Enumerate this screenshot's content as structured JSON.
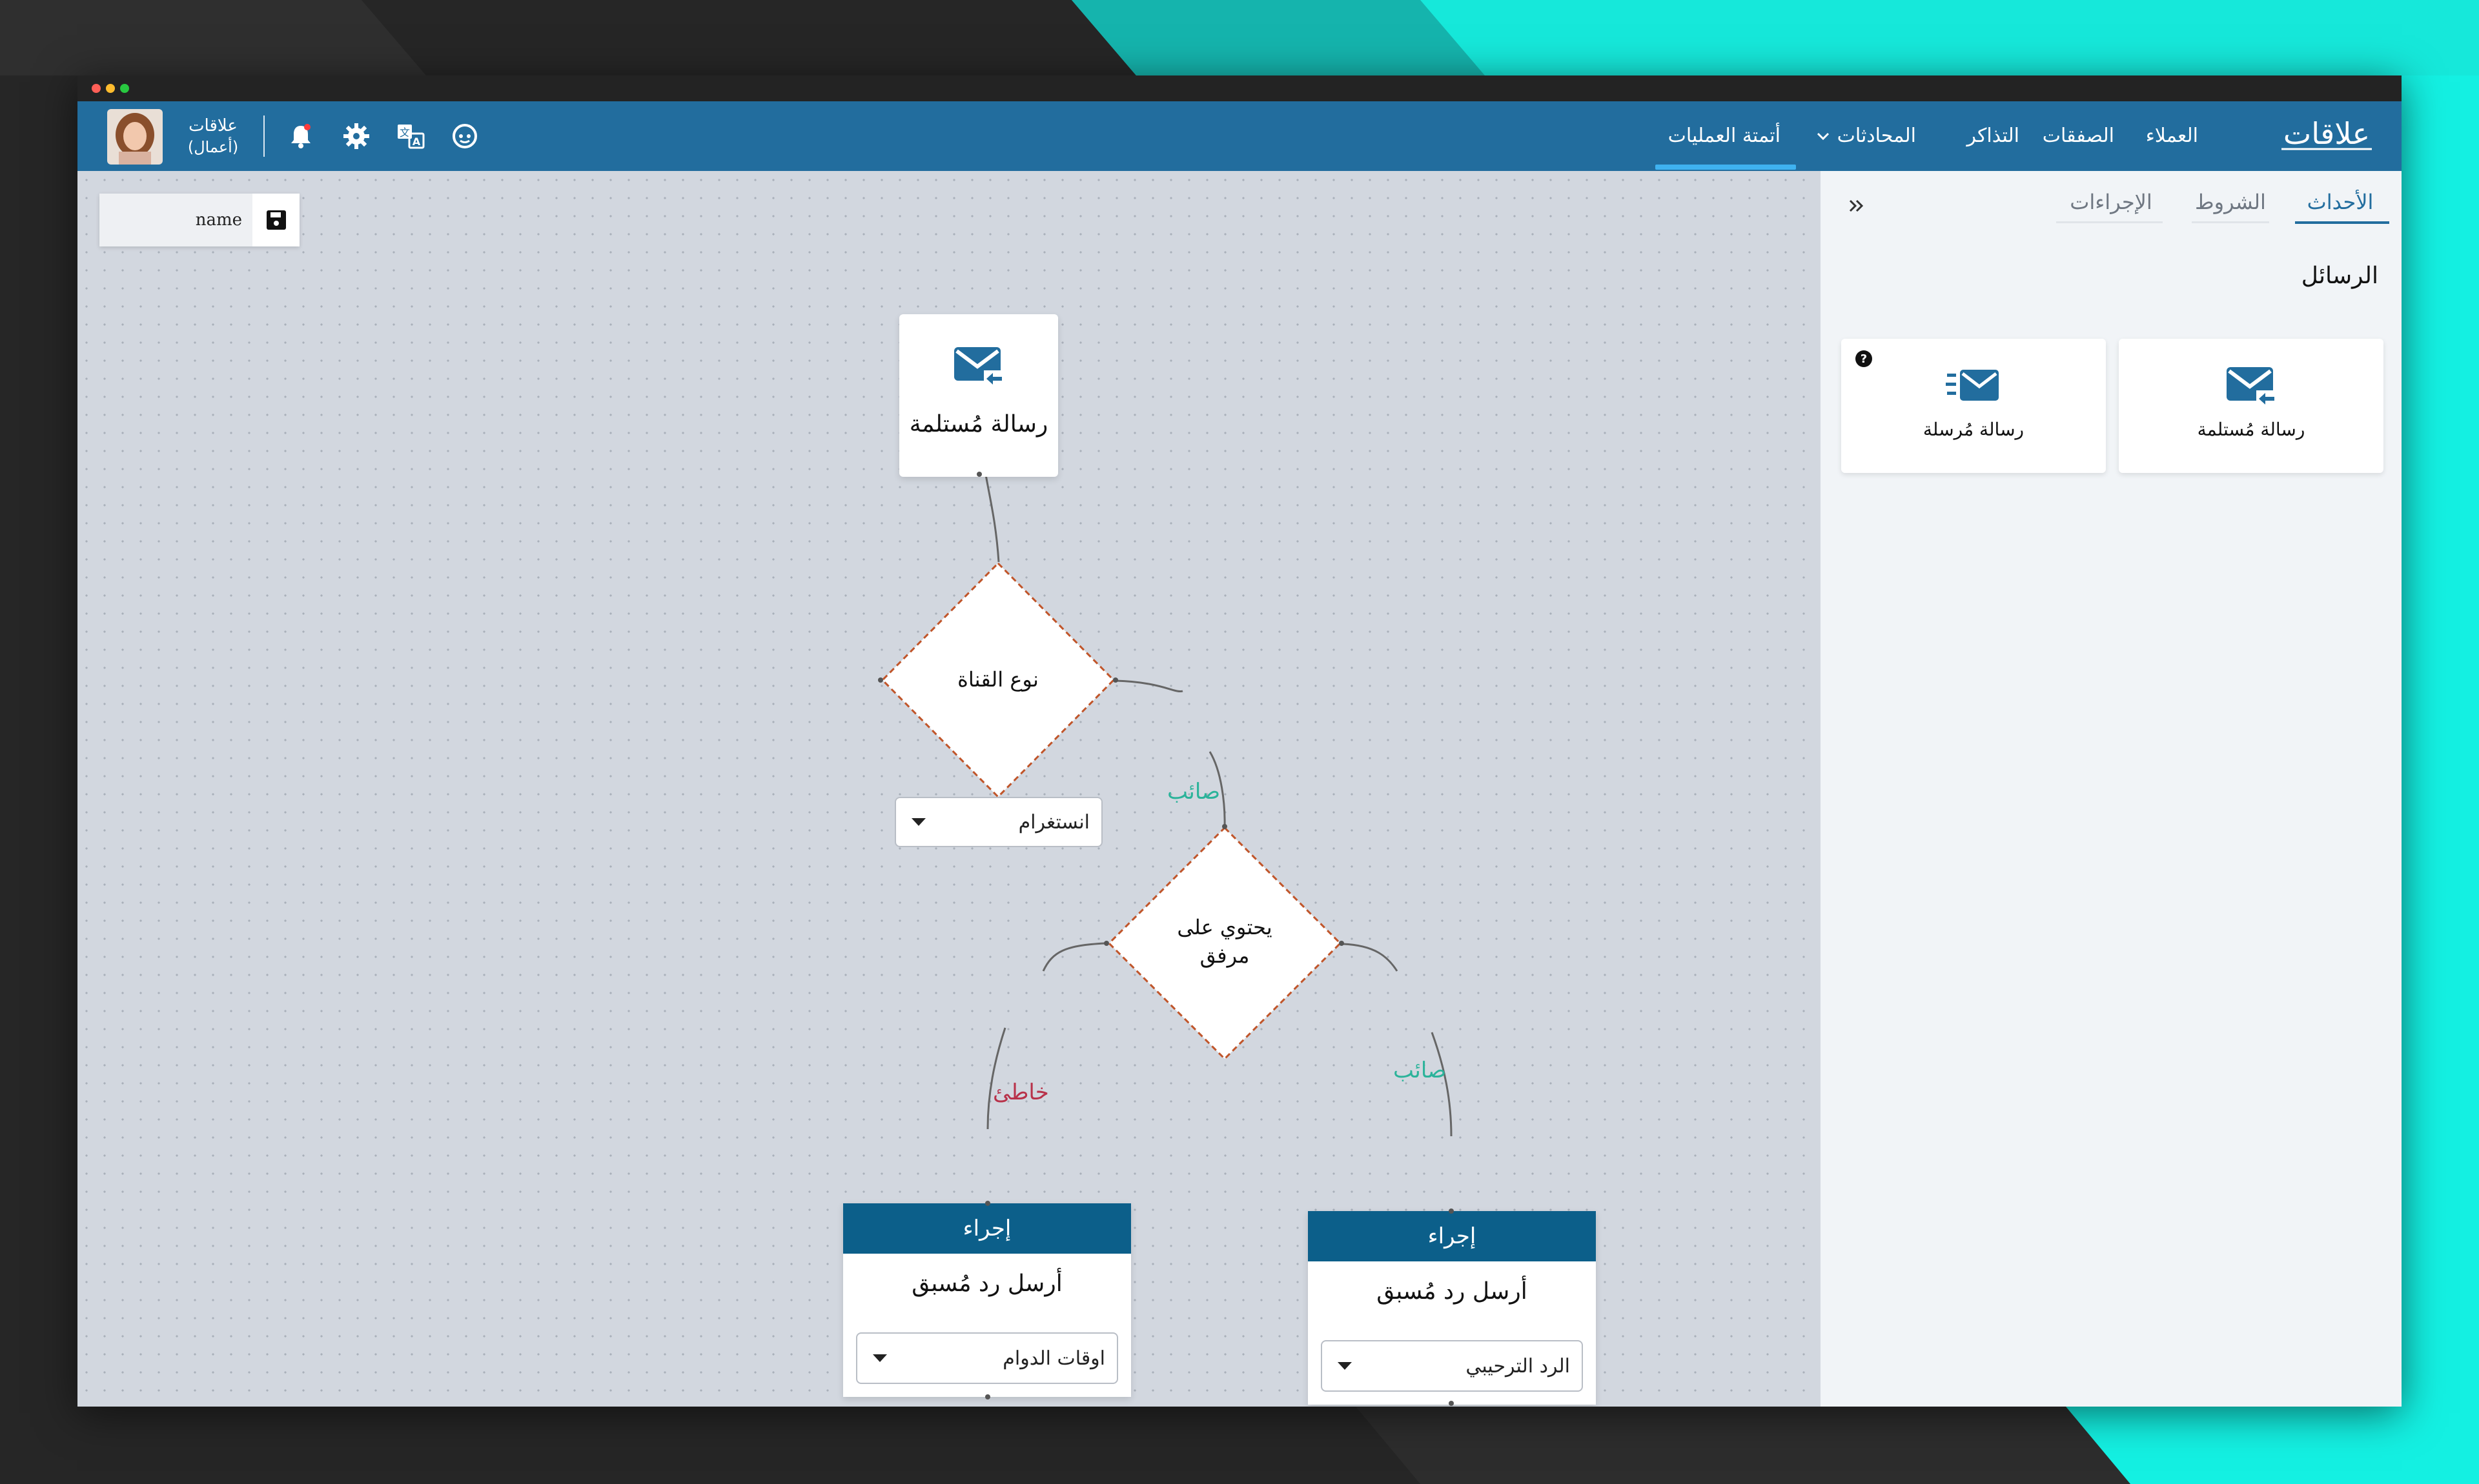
{
  "colors": {
    "accent": "#226d9e",
    "action_header": "#0c5f8a",
    "true_edge": "#2bb39a",
    "false_edge": "#b8324a",
    "diamond_border": "#c0552a",
    "background_teal": "#14f5e6"
  },
  "nav": {
    "logo_text": "علاقات",
    "items": [
      {
        "label": "العملاء"
      },
      {
        "label": "الصفقات"
      },
      {
        "label": "التذاكر"
      },
      {
        "label": "المحادثات"
      },
      {
        "label": "أتمتة العمليات"
      }
    ],
    "active_index": 4,
    "user": {
      "name": "علاقات",
      "role": "(أعمال)"
    },
    "icons": [
      "bell-icon",
      "gear-icon",
      "translate-icon",
      "support-icon",
      "chevron-down-icon",
      "avatar"
    ]
  },
  "canvas": {
    "name_input": {
      "value": "name",
      "placeholder": "name"
    },
    "trigger_node": {
      "title": "رسالة مُستلمة",
      "icon": "mail-in-icon"
    },
    "condition_channel": {
      "title": "نوع القناة",
      "selected": "انستغرام"
    },
    "condition_attachment": {
      "line1": "يحتوي على",
      "line2": "مرفق"
    },
    "edge_labels": {
      "true_1": "صائب",
      "true_2": "صائب",
      "false_1": "خاطئ"
    },
    "action_left": {
      "header": "إجراء",
      "title": "أرسل رد مُسبق",
      "selected": "اوقات الدوام"
    },
    "action_right": {
      "header": "إجراء",
      "title": "أرسل رد مُسبق",
      "selected": "الرد الترحيبي"
    }
  },
  "sidebar": {
    "tabs": [
      {
        "label": "الأحداث"
      },
      {
        "label": "الشروط"
      },
      {
        "label": "الإجراءات"
      }
    ],
    "active_tab": 0,
    "collapse_icon": "double-chevron-right-icon",
    "section_title": "الرسائل",
    "tiles": [
      {
        "label": "رسالة مُستلمة",
        "icon": "mail-in-icon"
      },
      {
        "label": "رسالة مُرسلة",
        "icon": "mail-out-icon"
      }
    ],
    "help_icon": "help-icon"
  }
}
